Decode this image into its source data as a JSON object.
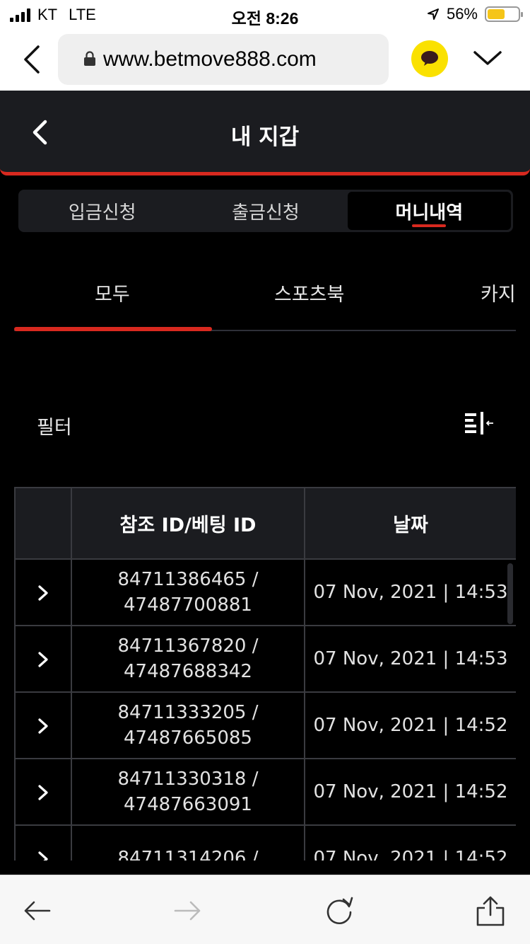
{
  "status_bar": {
    "carrier": "KT",
    "network": "LTE",
    "time": "오전 8:26",
    "battery": "56%",
    "battery_level": 0.56
  },
  "browser": {
    "url": "www.betmove888.com",
    "icons": [
      "back-chevron-icon",
      "lock-icon",
      "kakaotalk-icon",
      "chevron-down-icon"
    ]
  },
  "header": {
    "title": "내 지갑"
  },
  "segment_tabs": [
    {
      "label": "입금신청",
      "active": false
    },
    {
      "label": "출금신청",
      "active": false
    },
    {
      "label": "머니내역",
      "active": true
    }
  ],
  "category_tabs": [
    {
      "label": "모두",
      "active": true
    },
    {
      "label": "스포츠북",
      "active": false
    },
    {
      "label": "카지",
      "active": false
    }
  ],
  "filter": {
    "label": "필터",
    "icon": "filter-collapse-icon"
  },
  "table": {
    "headers": [
      "",
      "참조 ID/베팅 ID",
      "날짜"
    ],
    "rows": [
      {
        "ref_id": "84711386465 /",
        "bet_id": "47487700881",
        "date": "07 Nov, 2021 | 14:53"
      },
      {
        "ref_id": "84711367820 /",
        "bet_id": "47487688342",
        "date": "07 Nov, 2021 | 14:53"
      },
      {
        "ref_id": "84711333205 /",
        "bet_id": "47487665085",
        "date": "07 Nov, 2021 | 14:52"
      },
      {
        "ref_id": "84711330318 /",
        "bet_id": "47487663091",
        "date": "07 Nov, 2021 | 14:52"
      },
      {
        "ref_id": "84711314206 /",
        "bet_id": "",
        "date": "07 Nov, 2021 | 14:52"
      }
    ]
  },
  "colors": {
    "accent": "#d8291f",
    "background": "#000000",
    "panel": "#1b1c20"
  }
}
